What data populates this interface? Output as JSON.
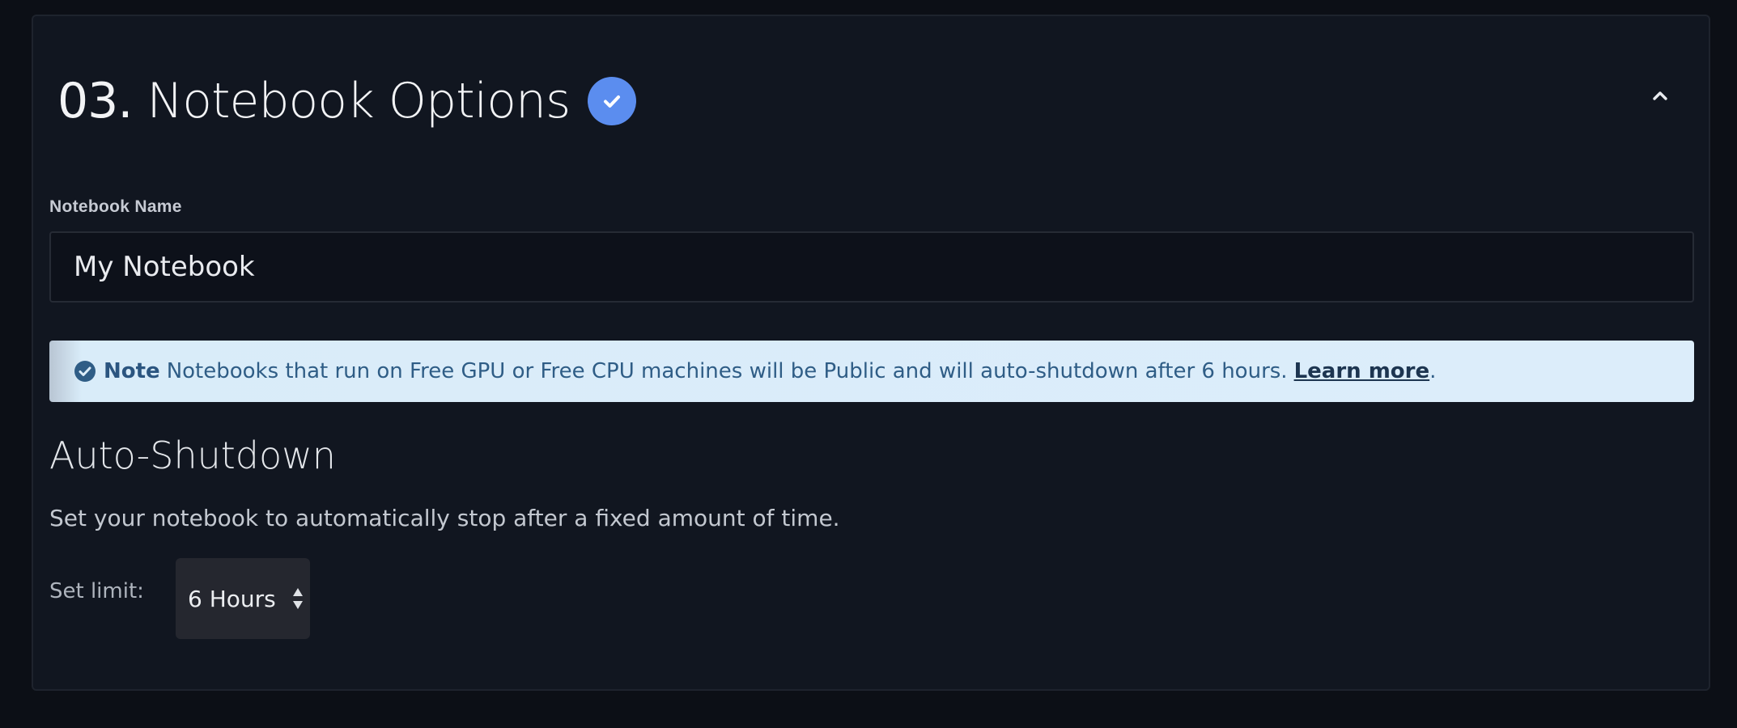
{
  "section": {
    "step_number": "03.",
    "title": "Notebook Options",
    "status_icon": "check-circle-icon",
    "collapse_icon": "chevron-up-icon"
  },
  "notebook_name": {
    "label": "Notebook Name",
    "value": "My Notebook"
  },
  "note": {
    "icon": "check-circle-icon",
    "strong": "Note",
    "text": "Notebooks that run on Free GPU or Free CPU machines will be Public and will auto-shutdown after 6 hours.",
    "link": "Learn more",
    "trailing": "."
  },
  "auto_shutdown": {
    "heading": "Auto-Shutdown",
    "description": "Set your notebook to automatically stop after a fixed amount of time.",
    "limit_label": "Set limit:",
    "selected": "6 Hours"
  },
  "colors": {
    "accent": "#5b8def",
    "background": "#111620",
    "note_background": "#dcedfa",
    "note_text": "#2f5d86"
  }
}
